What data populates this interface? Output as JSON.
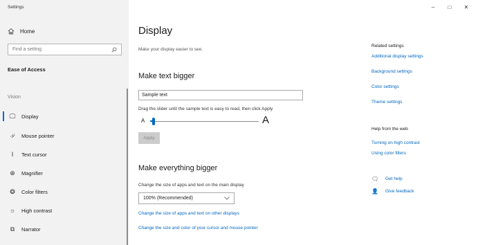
{
  "window": {
    "title": "Settings",
    "minimize": "–",
    "maximize": "□",
    "close": "✕"
  },
  "sidebar": {
    "home_label": "Home",
    "search_placeholder": "Find a setting",
    "section_title": "Ease of Access",
    "group_label": "Vision",
    "items": [
      {
        "label": "Display",
        "icon": "monitor-icon",
        "glyph": "🖵"
      },
      {
        "label": "Mouse pointer",
        "icon": "mouse-pointer-icon",
        "glyph": "⮰"
      },
      {
        "label": "Text cursor",
        "icon": "text-cursor-icon",
        "glyph": "I"
      },
      {
        "label": "Magnifier",
        "icon": "magnifier-icon",
        "glyph": "⊕"
      },
      {
        "label": "Color filters",
        "icon": "color-filters-icon",
        "glyph": "❂"
      },
      {
        "label": "High contrast",
        "icon": "high-contrast-icon",
        "glyph": "☼"
      },
      {
        "label": "Narrator",
        "icon": "narrator-icon",
        "glyph": "⧉"
      }
    ],
    "active_index": 0
  },
  "main": {
    "title": "Display",
    "subtitle": "Make your display easier to see.",
    "text_bigger": {
      "heading": "Make text bigger",
      "sample_text": "Sample text",
      "hint": "Drag the slider until the sample text is easy to read, then click Apply",
      "small_a": "A",
      "large_a": "A",
      "slider_fraction": 0.03,
      "apply_label": "Apply"
    },
    "everything_bigger": {
      "heading": "Make everything bigger",
      "label": "Change the size of apps and text on the main display",
      "dropdown_value": "100% (Recommended)",
      "link_other_displays": "Change the size of apps and text on other displays",
      "link_cursor": "Change the size and color of your cursor and mouse pointer"
    }
  },
  "related": {
    "title": "Related settings",
    "links": [
      "Additional display settings",
      "Background settings",
      "Color settings",
      "Theme settings"
    ]
  },
  "help_web": {
    "title": "Help from the web",
    "links": [
      "Turning on high contrast",
      "Using color filters"
    ]
  },
  "help_actions": {
    "get_help": "Get help",
    "give_feedback": "Give feedback"
  },
  "colors": {
    "accent": "#0067c0",
    "sidebar_bg": "#f2f2f2"
  }
}
